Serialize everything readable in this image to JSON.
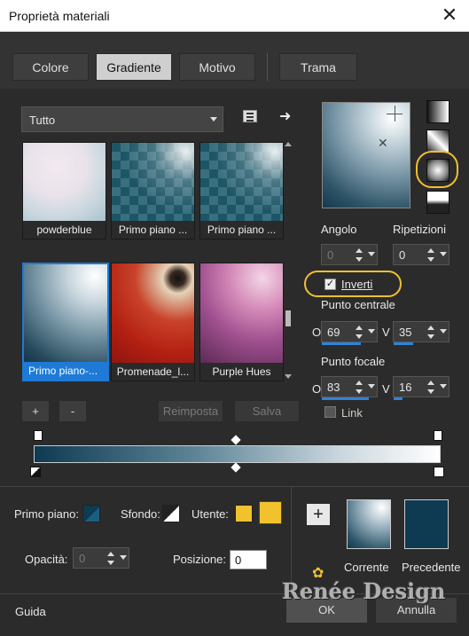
{
  "window": {
    "title": "Proprietà materiali",
    "close_glyph": "✕"
  },
  "tabs": [
    {
      "label": "Colore",
      "active": false
    },
    {
      "label": "Gradiente",
      "active": true
    },
    {
      "label": "Motivo",
      "active": false
    },
    {
      "label": "Trama",
      "active": false
    }
  ],
  "library": {
    "category": "Tutto",
    "thumbnails": [
      {
        "label": "powderblue",
        "selected": false
      },
      {
        "label": "Primo piano ...",
        "selected": false
      },
      {
        "label": "Primo piano ...",
        "selected": false
      },
      {
        "label": "Primo piano-...",
        "selected": true
      },
      {
        "label": "Promenade_l...",
        "selected": false
      },
      {
        "label": "Purple Hues",
        "selected": false
      }
    ]
  },
  "buttons": {
    "add": "+",
    "remove": "-",
    "reset": "Reimposta",
    "save": "Salva",
    "add_swatch": "+",
    "ok": "OK",
    "cancel": "Annulla",
    "help": "Guida"
  },
  "gradient": {
    "angle_label": "Angolo",
    "angle_value": "0",
    "repeats_label": "Ripetizioni",
    "repeats_value": "0",
    "invert_label": "Inverti",
    "invert_checked": true,
    "center_label": "Punto centrale",
    "center_h_label": "O",
    "center_h_value": "69",
    "center_v_label": "V",
    "center_v_value": "35",
    "focal_label": "Punto focale",
    "focal_h_label": "O",
    "focal_h_value": "83",
    "focal_v_label": "V",
    "focal_v_value": "16",
    "link_label": "Link",
    "link_checked": false
  },
  "bottom": {
    "foreground_label": "Primo piano:",
    "background_label": "Sfondo:",
    "user_label": "Utente:",
    "user_color": "#f2c12e",
    "opacity_label": "Opacità:",
    "opacity_value": "0",
    "position_label": "Posizione:",
    "position_value": "0",
    "current_label": "Corrente",
    "previous_label": "Precedente",
    "previous_color": "#0e3a52"
  },
  "watermark": "Renée Design",
  "colors": {
    "accent": "#1e7ad6",
    "highlight": "#f0c030",
    "gradient_dark": "#0e3a52",
    "gradient_light": "#ffffff"
  }
}
